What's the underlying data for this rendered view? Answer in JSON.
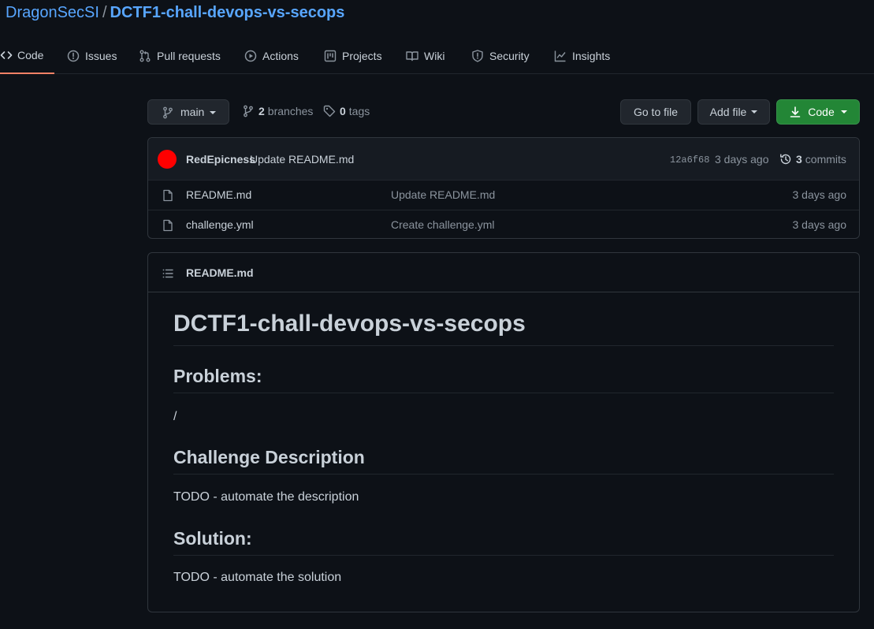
{
  "repo": {
    "owner": "DragonSecSI",
    "separator": "/",
    "name": "DCTF1-chall-devops-vs-secops"
  },
  "tabs": [
    {
      "label": "Code",
      "icon": "code-icon",
      "active": true
    },
    {
      "label": "Issues",
      "icon": "issue-opened-icon"
    },
    {
      "label": "Pull requests",
      "icon": "git-pull-request-icon"
    },
    {
      "label": "Actions",
      "icon": "play-icon"
    },
    {
      "label": "Projects",
      "icon": "project-icon"
    },
    {
      "label": "Wiki",
      "icon": "book-icon"
    },
    {
      "label": "Security",
      "icon": "shield-icon"
    },
    {
      "label": "Insights",
      "icon": "graph-icon"
    }
  ],
  "toolbar": {
    "branch": "main",
    "branches_count": "2",
    "branches_label": "branches",
    "tags_count": "0",
    "tags_label": "tags",
    "go_to_file": "Go to file",
    "add_file": "Add file",
    "code": "Code"
  },
  "latest_commit": {
    "avatar_color": "#ff0000",
    "author": "RedEpicness",
    "message": "Update README.md",
    "sha": "12a6f68",
    "time": "3 days ago",
    "commits_count": "3",
    "commits_label": "commits"
  },
  "files": [
    {
      "name": "README.md",
      "message": "Update README.md",
      "time": "3 days ago"
    },
    {
      "name": "challenge.yml",
      "message": "Create challenge.yml",
      "time": "3 days ago"
    }
  ],
  "readme": {
    "header": "README.md",
    "h1": "DCTF1-chall-devops-vs-secops",
    "problems_heading": "Problems:",
    "problems_text": "/",
    "description_heading": "Challenge Description",
    "description_text": "TODO - automate the description",
    "solution_heading": "Solution:",
    "solution_text": "TODO - automate the solution"
  },
  "colors": {
    "background": "#0d1117",
    "link": "#58a6ff",
    "active_tab_underline": "#f78166",
    "primary_button": "#238636"
  }
}
